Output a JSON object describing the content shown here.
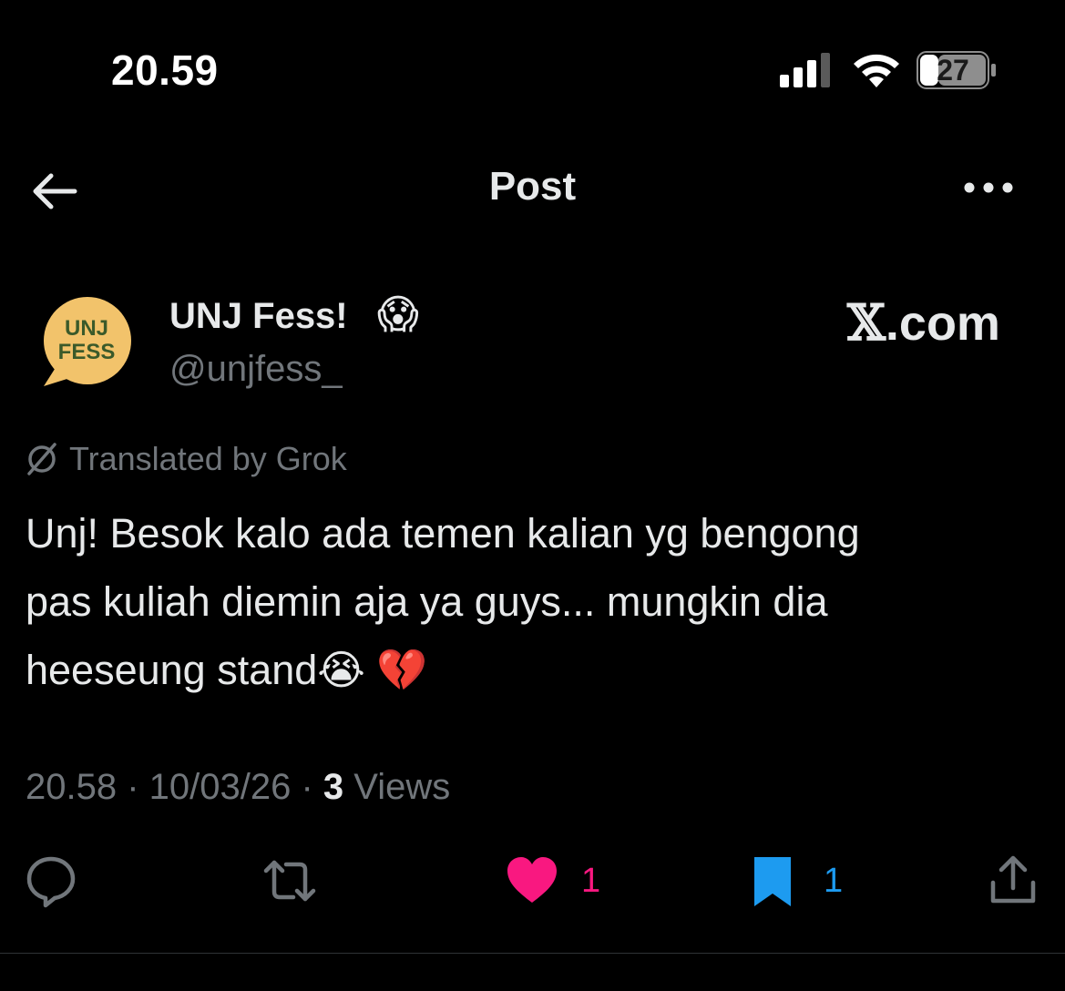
{
  "status_bar": {
    "time": "20.59",
    "battery_level": "27"
  },
  "header": {
    "title": "Post",
    "back_icon": "arrow-left-icon",
    "more_icon": "more-horizontal-icon"
  },
  "author": {
    "avatar_text_line1": "UNJ",
    "avatar_text_line2": "FESS",
    "display_name": "UNJ Fess!",
    "name_emoji": "😱",
    "handle": "@unjfess_",
    "watermark_x": "𝕏",
    "watermark_domain": ".com"
  },
  "translation": {
    "label": "Translated by Grok",
    "icon": "grok-icon"
  },
  "post": {
    "line1": "Unj! Besok kalo ada temen kalian yg bengong",
    "line2": "pas kuliah diemin aja ya guys... mungkin dia",
    "line3": "heeseung stand😭 💔"
  },
  "meta": {
    "time": "20.58",
    "separator": " · ",
    "date": "10/03/26",
    "views_count": "3",
    "views_label": " Views"
  },
  "actions": {
    "like_count": "1",
    "bookmark_count": "1"
  },
  "colors": {
    "background": "#000000",
    "text_primary": "#e7e9ea",
    "text_secondary": "#71767b",
    "like": "#f91880",
    "bookmark": "#1d9bf0",
    "avatar_bg": "#f2c36b",
    "avatar_text": "#3b5a2a"
  }
}
